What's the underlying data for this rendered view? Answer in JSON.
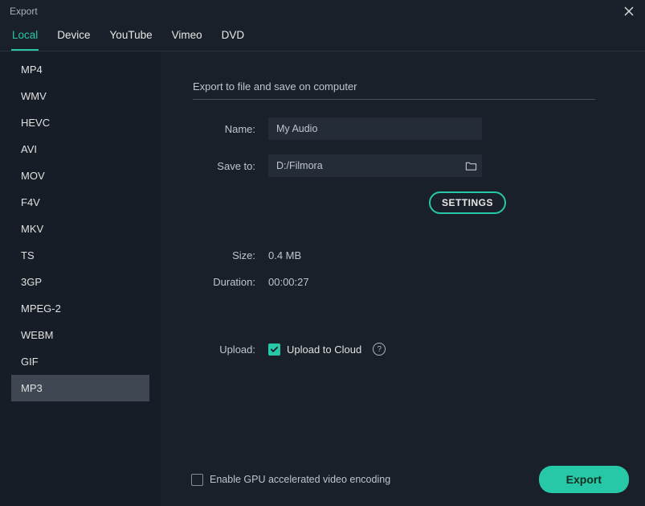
{
  "window_title": "Export",
  "tabs": [
    {
      "label": "Local",
      "active": true
    },
    {
      "label": "Device",
      "active": false
    },
    {
      "label": "YouTube",
      "active": false
    },
    {
      "label": "Vimeo",
      "active": false
    },
    {
      "label": "DVD",
      "active": false
    }
  ],
  "formats": [
    {
      "label": "MP4",
      "selected": false
    },
    {
      "label": "WMV",
      "selected": false
    },
    {
      "label": "HEVC",
      "selected": false
    },
    {
      "label": "AVI",
      "selected": false
    },
    {
      "label": "MOV",
      "selected": false
    },
    {
      "label": "F4V",
      "selected": false
    },
    {
      "label": "MKV",
      "selected": false
    },
    {
      "label": "TS",
      "selected": false
    },
    {
      "label": "3GP",
      "selected": false
    },
    {
      "label": "MPEG-2",
      "selected": false
    },
    {
      "label": "WEBM",
      "selected": false
    },
    {
      "label": "GIF",
      "selected": false
    },
    {
      "label": "MP3",
      "selected": true
    }
  ],
  "section_title": "Export to file and save on computer",
  "fields": {
    "name_label": "Name:",
    "name_value": "My Audio",
    "saveto_label": "Save to:",
    "saveto_value": "D:/Filmora"
  },
  "settings_button": "SETTINGS",
  "info": {
    "size_label": "Size:",
    "size_value": "0.4 MB",
    "duration_label": "Duration:",
    "duration_value": "00:00:27"
  },
  "upload": {
    "label": "Upload:",
    "checkbox_label": "Upload to Cloud",
    "checked": true
  },
  "footer": {
    "gpu_label": "Enable GPU accelerated video encoding",
    "gpu_checked": false,
    "export_button": "Export"
  },
  "help_glyph": "?"
}
